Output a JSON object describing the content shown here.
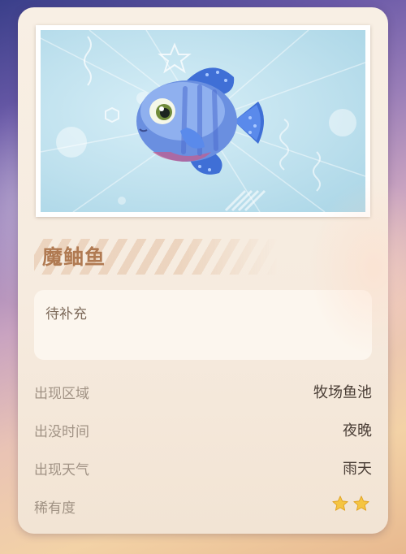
{
  "fish": {
    "name": "魔鲉鱼",
    "description": "待补充",
    "image_icon": "blue-fish-icon"
  },
  "details": [
    {
      "label": "出现区域",
      "value": "牧场鱼池"
    },
    {
      "label": "出没时间",
      "value": "夜晚"
    },
    {
      "label": "出现天气",
      "value": "雨天"
    }
  ],
  "rarity": {
    "label": "稀有度",
    "stars": 2,
    "max_stars": 2,
    "star_icon": "star-icon"
  },
  "colors": {
    "card_bg": "#f8efe4",
    "name_color": "#b07a52",
    "label_color": "#a09284",
    "value_color": "#4a3e36",
    "star_color": "#f5c542"
  }
}
